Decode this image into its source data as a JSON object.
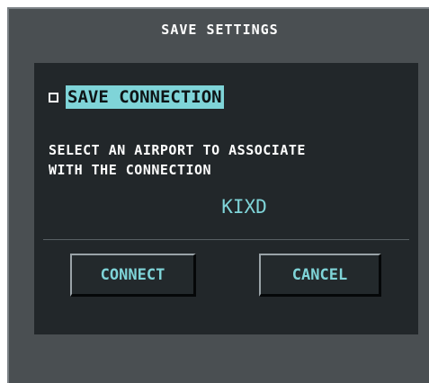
{
  "dialog": {
    "title": "SAVE SETTINGS",
    "save_connection": {
      "label": "SAVE CONNECTION",
      "checked": false
    },
    "instruction_line1": "SELECT AN AIRPORT TO ASSOCIATE",
    "instruction_line2": "WITH THE CONNECTION",
    "airport_identifier": "KIXD",
    "buttons": {
      "connect": "CONNECT",
      "cancel": "CANCEL"
    }
  },
  "colors": {
    "frame": "#4a4f52",
    "panel": "#22272a",
    "accent_cyan": "#7fd4d8",
    "text": "#ffffff"
  }
}
